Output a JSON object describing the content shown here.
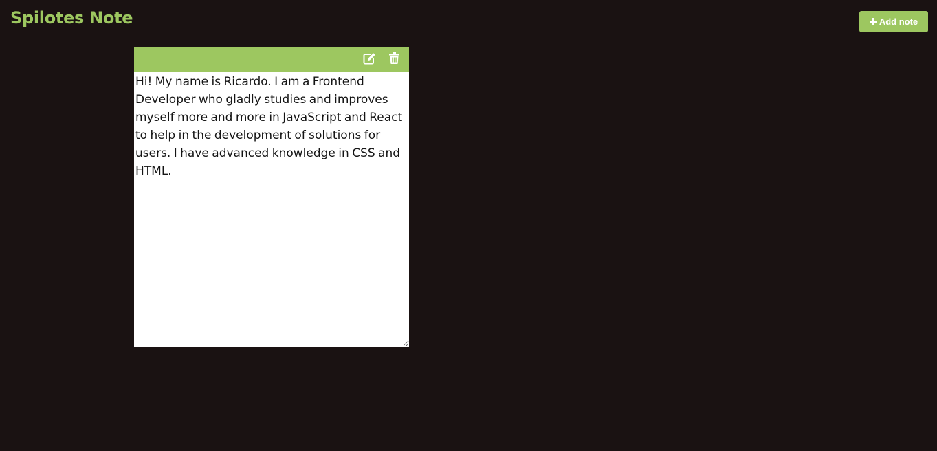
{
  "header": {
    "title": "Spilotes Note",
    "add_note_label": "Add note"
  },
  "note": {
    "text": "Hi! My name is Ricardo. I am a Frontend Developer who gladly studies and improves myself more and more in JavaScript and React to help in the development of solutions for users. I have advanced knowledge in CSS and HTML.",
    "toolbar_icons": [
      "edit-icon",
      "trash-icon"
    ]
  },
  "colors": {
    "background": "#1a1212",
    "accent": "#9dc760",
    "note_background": "#ffffff",
    "text": "#141414"
  },
  "icons": {
    "add_button": "plus-icon"
  }
}
